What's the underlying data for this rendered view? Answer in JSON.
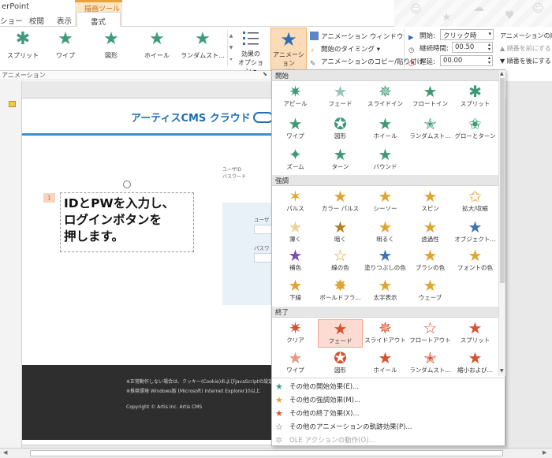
{
  "window": {
    "app_title": "erPoint",
    "tabs": [
      "ショー",
      "校閲",
      "表示"
    ],
    "context_group": "描画ツール",
    "context_tab": "書式"
  },
  "ribbon": {
    "effects": [
      {
        "label": "スプリット",
        "icon": "split-star-icon"
      },
      {
        "label": "ワイプ",
        "icon": "wipe-star-icon"
      },
      {
        "label": "図形",
        "icon": "shape-star-icon"
      },
      {
        "label": "ホイール",
        "icon": "wheel-star-icon"
      },
      {
        "label": "ランダムスト...",
        "icon": "random-bars-star-icon"
      }
    ],
    "effect_options_label": "効果の\nオプション",
    "add_animation_label": "アニメーション\nの追加",
    "animation_window": "アニメーション ウィンドウ",
    "trigger": "開始のタイミング",
    "anim_painter": "アニメーションのコピー/貼り付け",
    "start_label": "開始:",
    "start_value": "クリック時",
    "duration_label": "継続時間:",
    "duration_value": "00.50",
    "delay_label": "遅延:",
    "delay_value": "00.00",
    "order_title": "アニメーションの順序",
    "order_earlier": "順番を前にする",
    "order_later": "順番を後にする",
    "group_label": "アニメーション"
  },
  "slide": {
    "logo_text": "アーティスCMS クラウド",
    "login_top_text": [
      "ユーザID",
      "パスワード"
    ],
    "login_user_label": "ユーザ",
    "login_pass_label": "パスワ",
    "callout_lines": [
      "IDとPWを入力し、",
      "ログインボタンを",
      "押します。"
    ],
    "anim_tag": "1",
    "footer_lines": [
      "※正常動作しない場合は、クッキー(Cookie)およびJavaScriptの設定が有効になっているかご確認ください。",
      "※推奨環境 Windows版 (Microsoft) Internet Explorer10以上"
    ],
    "copyright": "Copyright © Artis Inc. Artis CMS"
  },
  "dropdown": {
    "sections": [
      {
        "title": "開始",
        "kind": "entrance",
        "items": [
          "アピール",
          "フェード",
          "スライドイン",
          "フロートイン",
          "スプリット",
          "ワイプ",
          "図形",
          "ホイール",
          "ランダムスト...",
          "グローとターン",
          "ズーム",
          "ターン",
          "バウンド"
        ]
      },
      {
        "title": "強調",
        "kind": "emphasis",
        "items": [
          "パルス",
          "カラー パルス",
          "シーソー",
          "スピン",
          "拡大/収縮",
          "薄く",
          "暗く",
          "明るく",
          "透過性",
          "オブジェクト...",
          "補色",
          "線の色",
          "塗りつぶしの色",
          "ブラシの色",
          "フォントの色",
          "下線",
          "ボールドフラ...",
          "太字表示",
          "ウェーブ"
        ]
      },
      {
        "title": "終了",
        "kind": "exit",
        "items": [
          "クリア",
          "フェード",
          "スライドアウト",
          "フロートアウト",
          "スプリット",
          "ワイプ",
          "図形",
          "ホイール",
          "ランダムスト...",
          "縮小および..."
        ]
      }
    ],
    "highlighted_item": "フェード",
    "more": [
      {
        "label": "その他の開始効果(E)...",
        "icon": "green-star-icon",
        "enabled": true
      },
      {
        "label": "その他の強調効果(M)...",
        "icon": "yellow-star-icon",
        "enabled": true
      },
      {
        "label": "その他の終了効果(X)...",
        "icon": "red-star-icon",
        "enabled": true
      },
      {
        "label": "その他のアニメーションの軌跡効果(P)...",
        "icon": "outline-star-icon",
        "enabled": true
      },
      {
        "label": "OLE アクションの動作(O)...",
        "icon": "gear-star-icon",
        "enabled": false
      }
    ]
  },
  "colors": {
    "entrance": "#3e9a76",
    "emphasis": "#e0a530",
    "exit": "#d9502f",
    "accent": "#f2b370"
  }
}
